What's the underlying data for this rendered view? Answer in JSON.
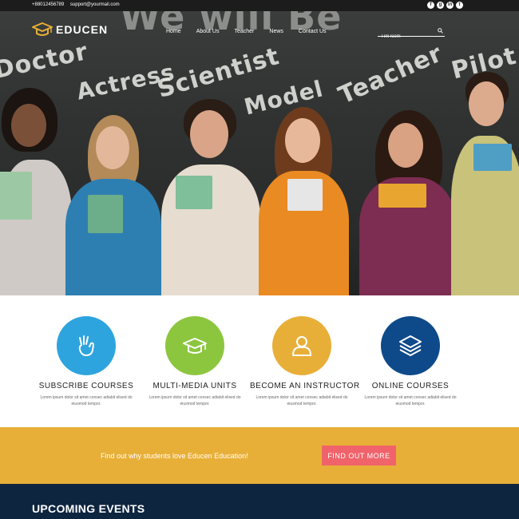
{
  "topbar": {
    "phone": "+88012456789",
    "email": "support@yourmail.com",
    "social": [
      "facebook-icon",
      "google-plus-icon",
      "linkedin-icon",
      "twitter-icon"
    ]
  },
  "header": {
    "logo_text": "EDUCEN",
    "nav": [
      "Home",
      "About Us",
      "Teacher",
      "News",
      "Contact Us"
    ],
    "search_placeholder": "Tìm kiếm"
  },
  "hero": {
    "chalkboard_words": [
      "We will Be",
      "Doctor",
      "Actress",
      "Scientist",
      "Model",
      "Teacher",
      "Pilot"
    ]
  },
  "features": [
    {
      "title": "SUBSCRIBE COURSES",
      "desc": "Lorem ipsum dolor sit amet consec adiabit elised do eiusmod tempor.",
      "color": "#2ea4de",
      "icon": "hand-icon"
    },
    {
      "title": "MULTI-MEDIA UNITS",
      "desc": "Lorem ipsum dolor sit amet consec adiabit elised do eiusmod tempor.",
      "color": "#8cc63f",
      "icon": "graduation-cap-icon"
    },
    {
      "title": "BECOME AN INSTRUCTOR",
      "desc": "Lorem ipsum dolor sit amet consec adiabit elised do eiusmod tempor.",
      "color": "#e8af38",
      "icon": "user-icon"
    },
    {
      "title": "ONLINE COURSES",
      "desc": "Lorem ipsum dolor sit amet consec adiabit elised do eiusmod tempor.",
      "color": "#0e4a8a",
      "icon": "layers-icon"
    }
  ],
  "cta": {
    "text": "Find out why students love Educen Education!",
    "button": "FIND OUT MORE"
  },
  "events": {
    "title": "UPCOMING EVENTS"
  },
  "colors": {
    "cta_bg": "#e8af38",
    "cta_button": "#f0636b",
    "events_bg": "#0e2540"
  }
}
